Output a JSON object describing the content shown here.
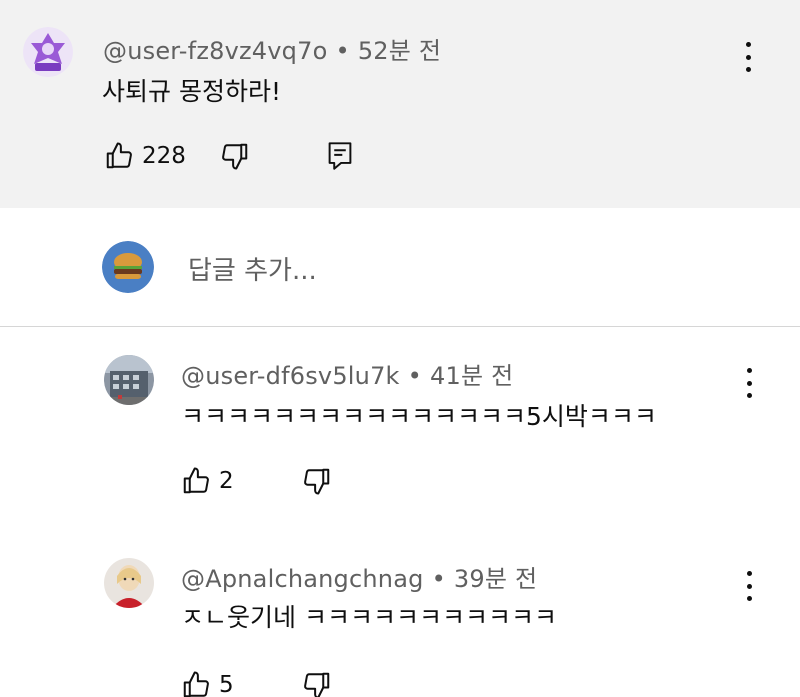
{
  "main_comment": {
    "author": "@user-fz8vz4vq7o",
    "separator": "•",
    "time": "52분 전",
    "text": "사퇴규 몽정하라!",
    "like_count": "228",
    "avatar_icon": "emblem-icon"
  },
  "reply_box": {
    "placeholder": "답글 추가...",
    "avatar_icon": "burger-avatar-icon"
  },
  "replies": [
    {
      "author": "@user-df6sv5lu7k",
      "separator": "•",
      "time": "41분 전",
      "text": "ㅋㅋㅋㅋㅋㅋㅋㅋㅋㅋㅋㅋㅋㅋㅋ5시박ㅋㅋㅋ",
      "like_count": "2"
    },
    {
      "author": "@Apnalchangchnag",
      "separator": "•",
      "time": "39분 전",
      "text": "ㅈㄴ웃기네 ㅋㅋㅋㅋㅋㅋㅋㅋㅋㅋㅋ",
      "like_count": "5"
    }
  ],
  "colors": {
    "main_bg": "#f2f2f2",
    "text": "#0f0f0f",
    "meta": "#606060",
    "divider": "#d6d6d6"
  }
}
